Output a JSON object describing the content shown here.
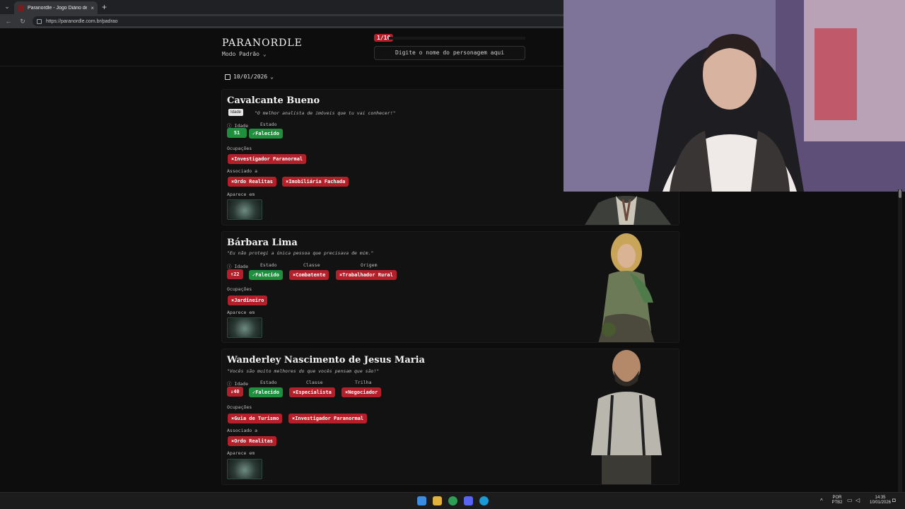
{
  "browser": {
    "tab_title": "Paranordle - Jogo Diário de Ordem",
    "tab_close": "×",
    "new_tab": "+",
    "url": "https://paranordle.com.br/padrao"
  },
  "header": {
    "logo": "PARANORDLE",
    "mode": "Modo Padrão",
    "counter": "1/10",
    "search_placeholder": "Digite o nome do personagem aqui"
  },
  "date": "10/01/2026",
  "tooltip": "Idade",
  "cards": [
    {
      "name": "Cavalcante Bueno",
      "quote": "\"O melhor analista de imóveis que tu vai conhecer!\"",
      "labels": {
        "idade": "Idade",
        "estado": "Estado"
      },
      "idade": "51",
      "estado": "✓Falecido",
      "ocupacoes_label": "Ocupações",
      "ocupacoes": [
        "×Investigador Paranormal"
      ],
      "associado_label": "Associado a",
      "associado": [
        "×Ordo Realitas",
        "×Imobiliária Fachada"
      ],
      "aparece_label": "Aparece em"
    },
    {
      "name": "Bárbara Lima",
      "quote": "\"Eu não protegi a única pessoa que precisava de mim.\"",
      "labels": {
        "idade": "Idade",
        "estado": "Estado",
        "classe": "Classe",
        "origem": "Origem"
      },
      "idade": "↑22",
      "estado": "✓Falecido",
      "classe": "×Combatente",
      "origem": "×Trabalhador Rural",
      "ocupacoes_label": "Ocupações",
      "ocupacoes": [
        "×Jardineiro"
      ],
      "aparece_label": "Aparece em"
    },
    {
      "name": "Wanderley Nascimento de Jesus Maria",
      "quote": "\"Vocês são muito melhores do que vocês pensam que são!\"",
      "labels": {
        "idade": "Idade",
        "estado": "Estado",
        "classe": "Classe",
        "trilha": "Trilha"
      },
      "idade": "↓40",
      "estado": "✓Falecido",
      "classe": "×Especialista",
      "trilha": "×Negociador",
      "ocupacoes_label": "Ocupações",
      "ocupacoes": [
        "×Guia de Turismo",
        "×Investigador Paranormal"
      ],
      "associado_label": "Associado a",
      "associado": [
        "×Ordo Realitas"
      ],
      "aparece_label": "Aparece em"
    }
  ],
  "taskbar": {
    "lang": "POR",
    "layout": "PTB2",
    "time": "14:35",
    "date": "10/01/2026"
  },
  "colors": {
    "wrong": "#b3202a",
    "correct": "#1f8f3e",
    "background": "#0d0d0d"
  }
}
